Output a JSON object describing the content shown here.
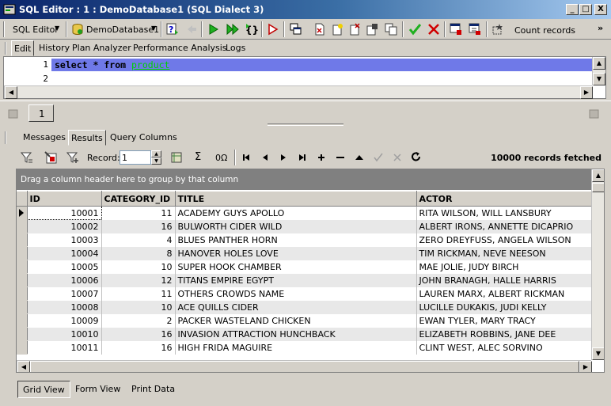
{
  "window": {
    "title": "SQL Editor : 1 : DemoDatabase1 (SQL Dialect 3)",
    "minimize": "_",
    "maximize": "□",
    "close": "X"
  },
  "toolbar": {
    "editor_mode": "SQL Editor",
    "database": "DemoDatabase1",
    "count_records": "Count records",
    "more": "»"
  },
  "editor_tabs": [
    "Edit",
    "History",
    "Plan Analyzer",
    "Performance Analysis",
    "Logs"
  ],
  "editor": {
    "line_numbers": [
      "1",
      "2"
    ],
    "sql": {
      "select": "select",
      "star": "*",
      "from": "from",
      "table": "product"
    }
  },
  "query_tab": "1",
  "result_tabs": [
    "Messages",
    "Results",
    "Query Columns"
  ],
  "results_toolbar": {
    "record_label": "Record:",
    "record_value": "1",
    "sigma": "Σ",
    "oo": "0Ω",
    "fetched": "10000 records fetched"
  },
  "grid": {
    "group_hint": "Drag a column header here to group by that column",
    "columns": [
      "ID",
      "CATEGORY_ID",
      "TITLE",
      "ACTOR"
    ],
    "rows": [
      [
        "10001",
        "11",
        "ACADEMY GUYS APOLLO",
        "RITA WILSON,  WILL LANSBURY"
      ],
      [
        "10002",
        "16",
        "BULWORTH CIDER WILD",
        "ALBERT IRONS,  ANNETTE DICAPRIO"
      ],
      [
        "10003",
        "4",
        "BLUES PANTHER HORN",
        "ZERO DREYFUSS,  ANGELA WILSON"
      ],
      [
        "10004",
        "8",
        "HANOVER HOLES LOVE",
        "TIM RICKMAN,  NEVE NEESON"
      ],
      [
        "10005",
        "10",
        "SUPER HOOK CHAMBER",
        "MAE JOLIE,  JUDY BIRCH"
      ],
      [
        "10006",
        "12",
        "TITANS EMPIRE EGYPT",
        "JOHN BRANAGH,  HALLE HARRIS"
      ],
      [
        "10007",
        "11",
        "OTHERS CROWDS NAME",
        "LAUREN MARX,  ALBERT RICKMAN"
      ],
      [
        "10008",
        "10",
        "ACE QUILLS CIDER",
        "LUCILLE DUKAKIS,  JUDI KELLY"
      ],
      [
        "10009",
        "2",
        "PACKER WASTELAND CHICKEN",
        "EWAN TYLER,  MARY TRACY"
      ],
      [
        "10010",
        "16",
        "INVASION ATTRACTION HUNCHBACK",
        "ELIZABETH ROBBINS,  JANE DEE"
      ],
      [
        "10011",
        "16",
        "HIGH FRIDA MAGUIRE",
        "CLINT WEST,  ALEC SORVINO"
      ]
    ]
  },
  "bottom_tabs": [
    "Grid View",
    "Form View",
    "Print Data"
  ],
  "colors": {
    "title_start": "#0a246a",
    "title_end": "#a6caf0",
    "selection": "#6f79e8",
    "keyword": "#000000",
    "identifier": "#00a000"
  }
}
